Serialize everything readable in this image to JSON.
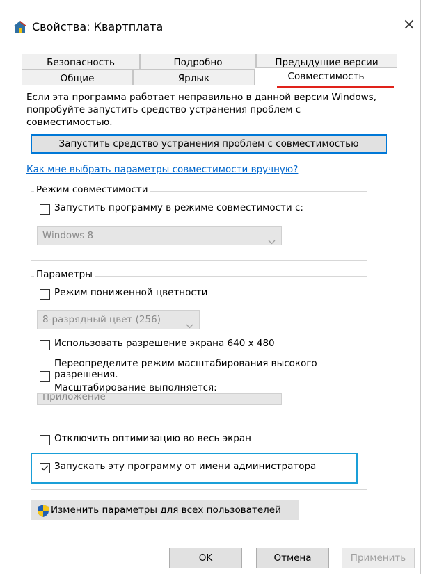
{
  "window": {
    "title": "Свойства: Квартплата",
    "icon": "house-icon",
    "close_label": "×"
  },
  "tabs": {
    "row1": [
      "Безопасность",
      "Подробно",
      "Предыдущие версии"
    ],
    "row2": [
      "Общие",
      "Ярлык",
      "Совместимость"
    ],
    "active": "Совместимость"
  },
  "compat": {
    "description": "Если эта программа работает неправильно в данной версии Windows, попробуйте запустить средство устранения проблем с совместимостью.",
    "troubleshoot_button": "Запустить средство устранения проблем с совместимостью",
    "manual_link": "Как мне выбрать параметры совместимости вручную?",
    "mode_group": {
      "label": "Режим совместимости",
      "checkbox_label": "Запустить программу в режиме совместимости с:",
      "checked": false,
      "select_value": "Windows 8"
    },
    "params_group": {
      "label": "Параметры",
      "reduced_color": {
        "label": "Режим пониженной цветности",
        "checked": false
      },
      "color_select_value": "8-разрядный цвет (256)",
      "res640": {
        "label": "Использовать разрешение экрана 640 x 480",
        "checked": false
      },
      "dpi": {
        "line1": "Переопределите режим масштабирования высокого",
        "line2": "разрешения.",
        "line3": "Масштабирование выполняется:",
        "checked": false,
        "select_value": "Приложение"
      },
      "disable_fullscreen": {
        "label": "Отключить оптимизацию во весь экран",
        "checked": false
      },
      "run_as_admin": {
        "label": "Запускать эту программу от имени администратора",
        "checked": true
      }
    },
    "all_users_button": "Изменить параметры для всех пользователей",
    "shield_icon": "shield-icon"
  },
  "footer": {
    "ok": "OK",
    "cancel": "Отмена",
    "apply": "Применить"
  },
  "colors": {
    "accent": "#0078d7",
    "highlight_box": "#1a9fd8",
    "tab_underline": "#e0221a",
    "link": "#0066cc"
  }
}
